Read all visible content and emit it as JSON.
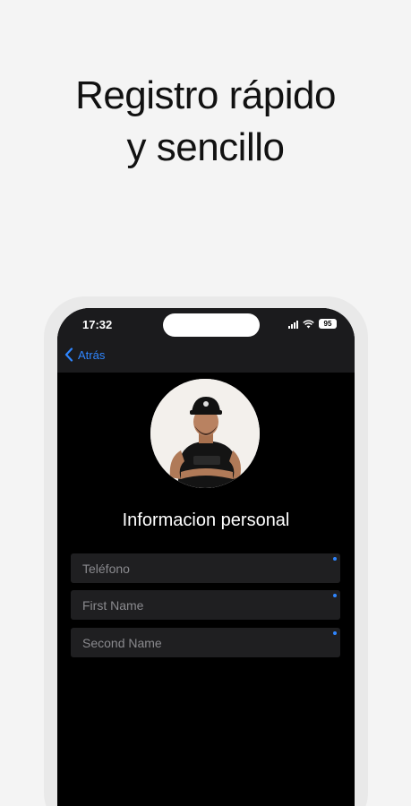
{
  "headline": {
    "line1": "Registro rápido",
    "line2": "y sencillo"
  },
  "status_bar": {
    "time": "17:32",
    "battery": "95"
  },
  "nav": {
    "back_label": "Atrás"
  },
  "profile": {
    "section_title": "Informacion personal"
  },
  "form": {
    "fields": [
      {
        "placeholder": "Teléfono",
        "required": true
      },
      {
        "placeholder": "First Name",
        "required": true
      },
      {
        "placeholder": "Second Name",
        "required": true
      }
    ]
  },
  "colors": {
    "accent": "#2f86ff",
    "background": "#f4f4f4",
    "screen": "#000000",
    "field": "#1f1f21"
  }
}
